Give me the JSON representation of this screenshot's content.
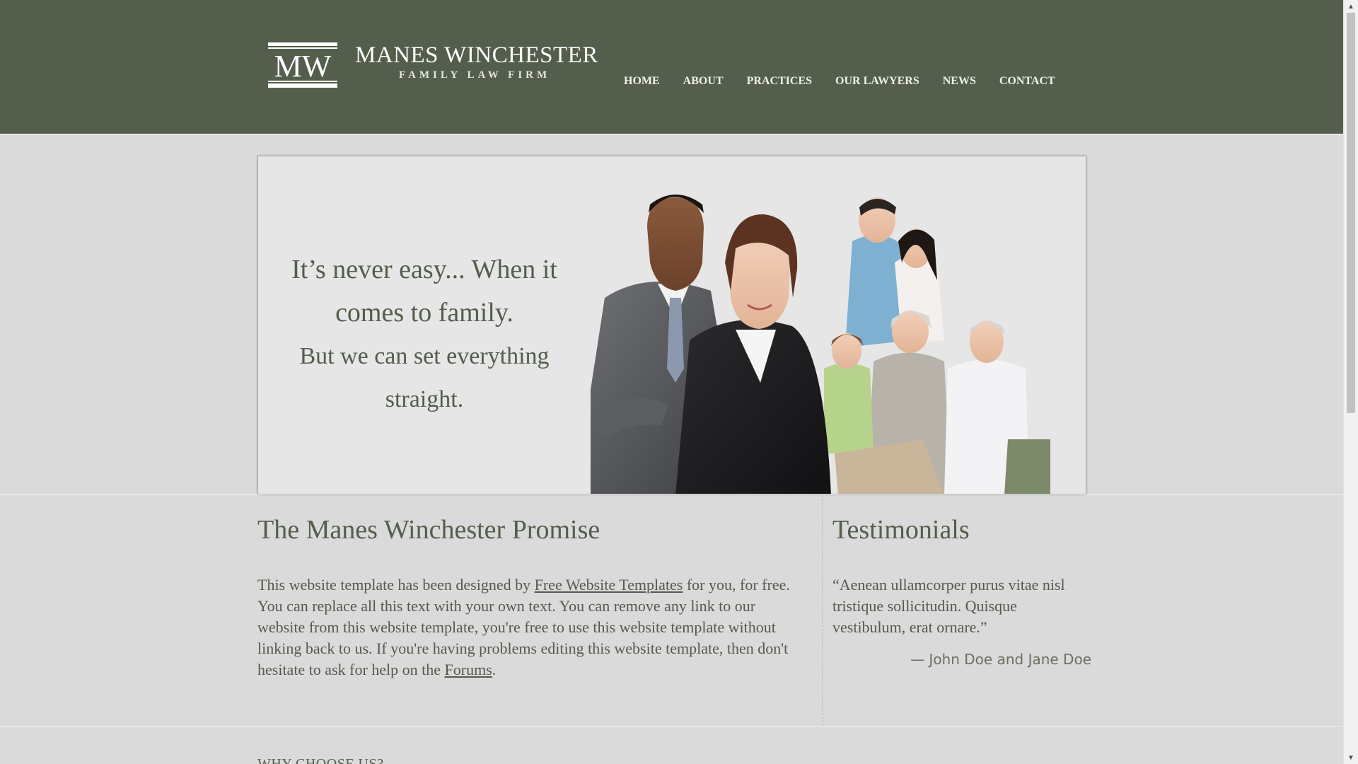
{
  "brand": {
    "monogram": "MW",
    "name": "MANES WINCHESTER",
    "tagline": "FAMILY LAW FIRM"
  },
  "nav": {
    "items": [
      {
        "label": "HOME"
      },
      {
        "label": "ABOUT"
      },
      {
        "label": "PRACTICES"
      },
      {
        "label": "OUR LAWYERS"
      },
      {
        "label": "NEWS"
      },
      {
        "label": "CONTACT"
      }
    ]
  },
  "hero": {
    "line1a": "It’s never easy... When it",
    "line1b": "comes to family.",
    "line2a": "But we can set everything",
    "line2b": "straight."
  },
  "promise": {
    "title": "The Manes Winchester Promise",
    "text_before_link": "This website template has been designed by ",
    "link1": "Free Website Templates",
    "text_middle": " for you, for free. You can replace all this text with your own text. You can remove any link to our website from this website template, you're free to use this website template without linking back to us. If you're having problems editing this website template, then don't hesitate to ask for help on the ",
    "link2": "Forums",
    "text_end": "."
  },
  "testimonials": {
    "title": "Testimonials",
    "quote": "“Aenean ullamcorper purus vitae nisl tristique sollicitudin. Quisque vestibulum, erat ornare.”",
    "author": "— John Doe and Jane Doe"
  },
  "why": {
    "heading": "WHY CHOOSE US?"
  },
  "colors": {
    "header_bg": "#545e4d",
    "page_bg": "#dadada",
    "hero_bg": "#e6e6e6",
    "text": "#555a4c"
  }
}
